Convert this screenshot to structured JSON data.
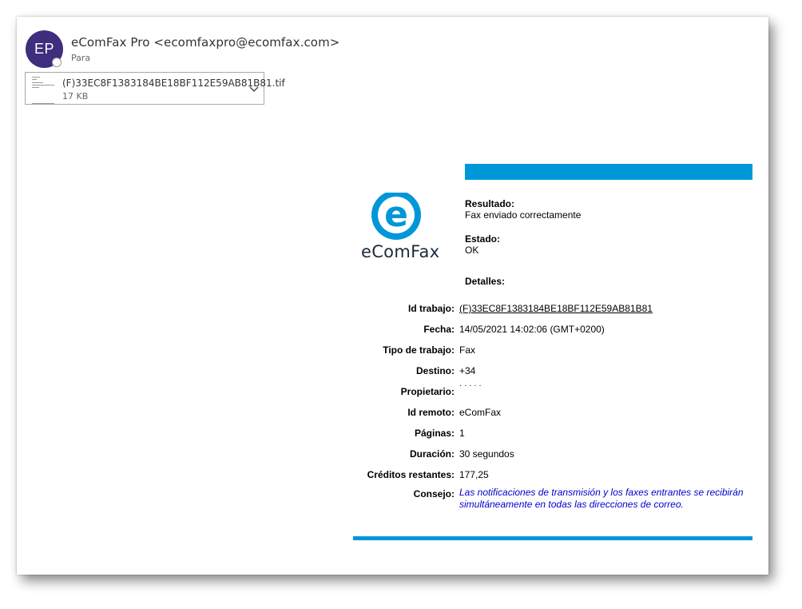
{
  "header": {
    "avatar_initials": "EP",
    "sender": "eComFax Pro <ecomfaxpro@ecomfax.com>",
    "to_label": "Para"
  },
  "attachment": {
    "file_name": "(F)33EC8F1383184BE18BF112E59AB81B81.tif",
    "size": "17 KB"
  },
  "logo": {
    "letter": "e",
    "brand": "eComFax",
    "brand_color": "#0097d9"
  },
  "result": {
    "label": "Resultado:",
    "value": "Fax enviado correctamente"
  },
  "status": {
    "label": "Estado:",
    "value": "OK"
  },
  "details_label": "Detalles:",
  "details": [
    {
      "label": "Id trabajo:",
      "value": "(F)33EC8F1383184BE18BF112E59AB81B81"
    },
    {
      "label": "Fecha:",
      "value": "14/05/2021 14:02:06 (GMT+0200)"
    },
    {
      "label": "Tipo de trabajo:",
      "value": "Fax"
    },
    {
      "label": "Destino:",
      "value": "+34"
    },
    {
      "label": "Propietario:",
      "value": "· · ·  ·   ·"
    },
    {
      "label": "Id remoto:",
      "value": "eComFax"
    },
    {
      "label": "Páginas:",
      "value": "1"
    },
    {
      "label": "Duración:",
      "value": "30 segundos"
    },
    {
      "label": "Créditos restantes:",
      "value": "177,25"
    }
  ],
  "advice": {
    "label": "Consejo:",
    "text": "Las notificaciones de transmisión y los faxes entrantes se recibirán simultáneamente en todas las direcciones de correo."
  },
  "colors": {
    "accent_bar": "#0097d9",
    "avatar_bg": "#3f2d7e",
    "advice_text": "#0000cc"
  }
}
